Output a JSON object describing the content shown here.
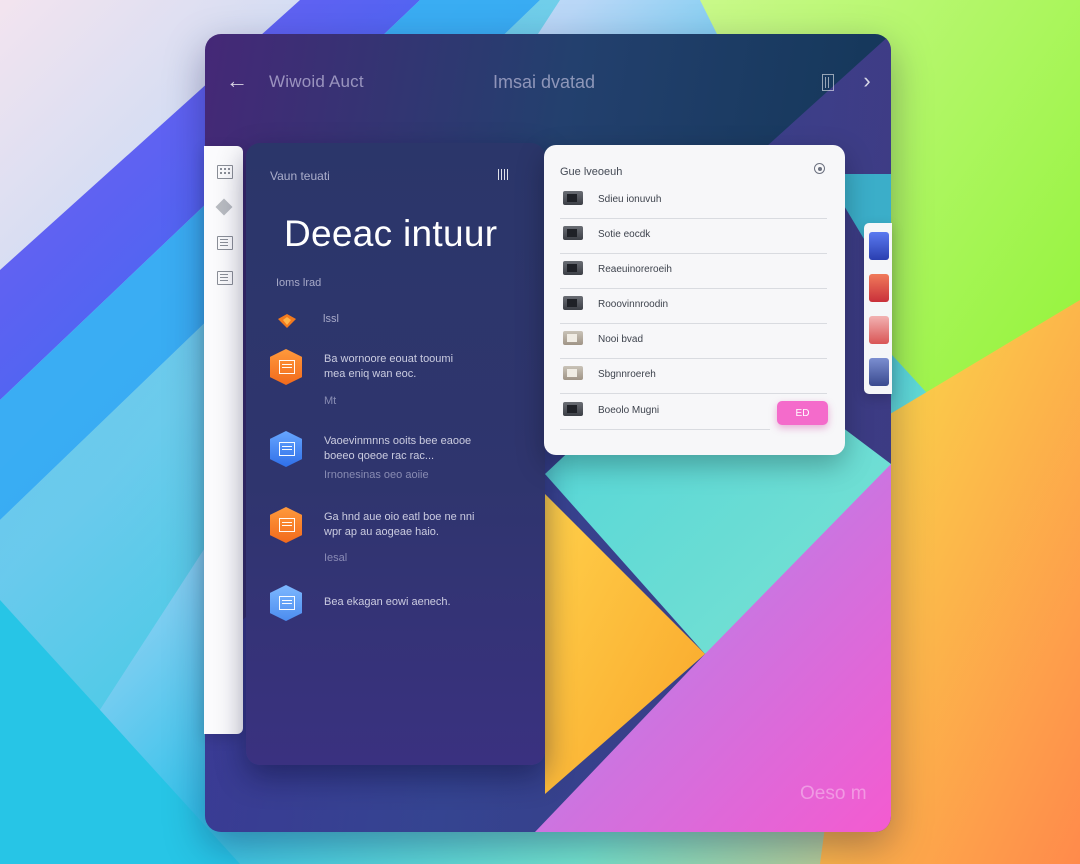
{
  "topbar": {
    "back_icon": "arrow-left-icon",
    "left_title": "Wiwoid Auct",
    "center_title": "Imsai dvatad",
    "forward_icon": "chevron-right-icon"
  },
  "side_rail": {
    "icons": [
      "grid-icon",
      "diamond-icon",
      "list-icon",
      "list-icon"
    ]
  },
  "panel": {
    "subtitle": "Vaun teuati",
    "heading": "Deeac intuur",
    "section_label": "Ioms lrad",
    "small_row_label": "lssl",
    "features": [
      {
        "icon_color": "orange",
        "lines": [
          "Ba wornoore eouat tooumi",
          "mea eniq wan eoc."
        ],
        "meta": "Mt"
      },
      {
        "icon_color": "blue",
        "lines": [
          "Vaoevinmnns ooits bee eaooe",
          "boeeo qoeoe rac rac..."
        ],
        "meta": "Irnonesinas oeo aoiie"
      },
      {
        "icon_color": "orange",
        "lines": [
          "Ga hnd aue oio eatl boe ne nni",
          "wpr ap au aogeae haio."
        ],
        "meta": "Iesal"
      },
      {
        "icon_color": "lightblue",
        "lines": [
          "Bea ekagan eowi aenech."
        ],
        "meta": ""
      }
    ]
  },
  "card": {
    "title": "Gue lveoeuh",
    "rows": [
      {
        "label": "Sdieu ionuvuh",
        "thumb": "dark"
      },
      {
        "label": "Sotie eocdk",
        "thumb": "dark"
      },
      {
        "label": "Reaeuinoreroeih",
        "thumb": "dark"
      },
      {
        "label": "Rooovinnroodin",
        "thumb": "dark"
      },
      {
        "label": "Nooi bvad",
        "thumb": "light"
      },
      {
        "label": "Sbgnnroereh",
        "thumb": "dark"
      },
      {
        "label": "Boeolo Mugni",
        "thumb": "dark"
      }
    ],
    "button_label": "ED"
  },
  "right_strip": {
    "thumbs": [
      {
        "color": "#3a5ad8"
      },
      {
        "color": "#e0484b"
      },
      {
        "color": "#e86a6a"
      },
      {
        "color": "#5a6fb5"
      }
    ]
  },
  "colors": {
    "accent_pink": "#f46bcb",
    "accent_orange": "#f26a1c",
    "accent_blue": "#2f6fe8",
    "panel_bg": "#2f356e",
    "card_bg": "#f7f7f9"
  },
  "watermark": "Oeso m"
}
